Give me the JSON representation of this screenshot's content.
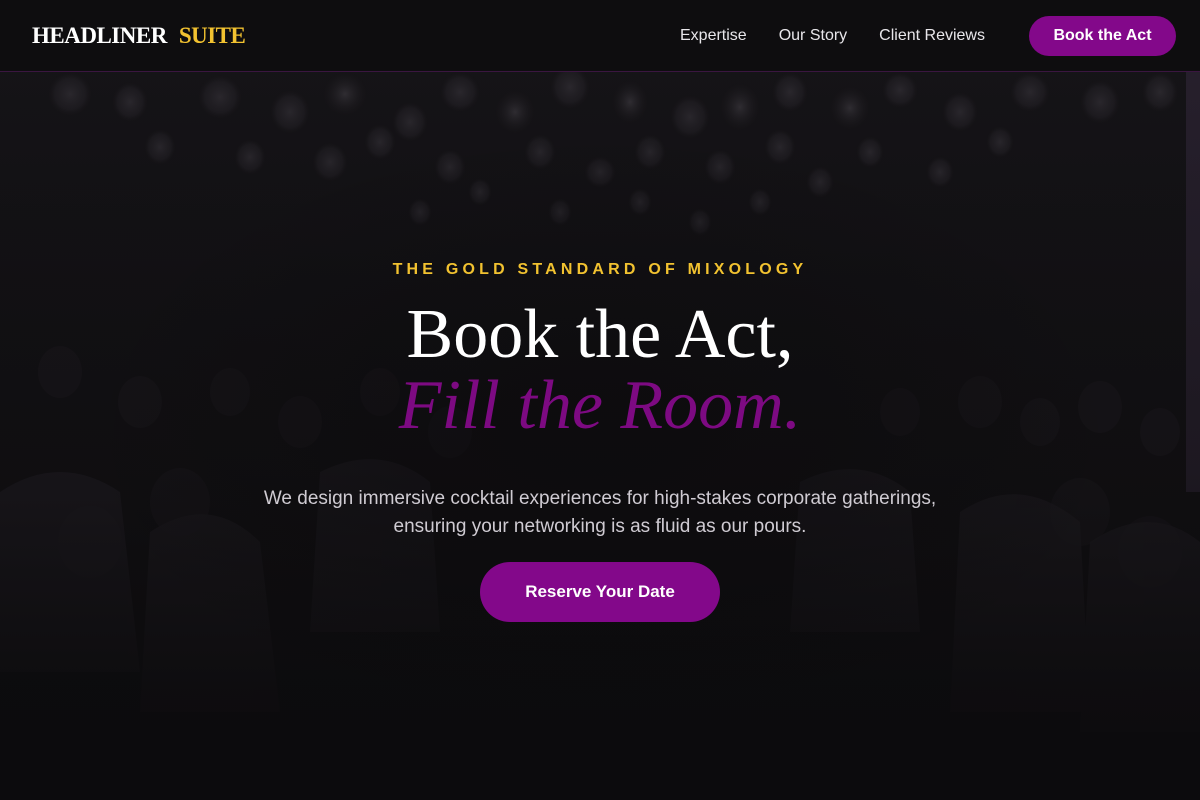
{
  "brand": {
    "name_main": "HEADLINER",
    "name_accent": "SUITE"
  },
  "nav": {
    "links": [
      {
        "label": "Expertise"
      },
      {
        "label": "Our Story"
      },
      {
        "label": "Client Reviews"
      }
    ],
    "cta_label": "Book the Act"
  },
  "hero": {
    "eyebrow": "THE GOLD STANDARD OF MIXOLOGY",
    "headline_line1": "Book the Act,",
    "headline_line2": "Fill the Room.",
    "subtitle": "We design immersive cocktail experiences for high-stakes corporate gatherings, ensuring your networking is as fluid as our pours.",
    "cta_label": "Reserve Your Date"
  },
  "colors": {
    "accent_purple": "#83088a",
    "accent_gold": "#f2c230",
    "background": "#0e0d0f"
  }
}
